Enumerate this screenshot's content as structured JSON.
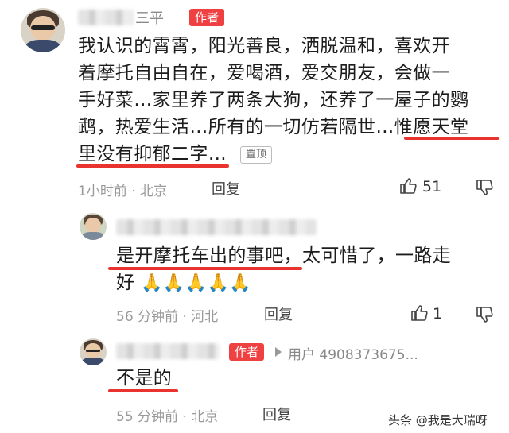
{
  "comment1": {
    "author_suffix": "三平",
    "author_tag": "作者",
    "lines": [
      "我认识的霄霄，阳光善良，洒脱温和，喜欢开",
      "着摩托自由自在，爱喝酒，爱交朋友，会做一",
      "手好菜…家里养了两条大狗，还养了一屋子的鹦",
      "鹉，热爱生活…所有的一切仿若隔世…惟愿天堂",
      "里没有抑郁二字…"
    ],
    "pin_label": "置顶",
    "meta": "1小时前 · 北京",
    "reply_label": "回复",
    "likes": "51"
  },
  "reply1": {
    "lines": [
      "是开摩托车出的事吧，太可惜了，一路走",
      "好"
    ],
    "emoji": [
      "🙏",
      "🙏",
      "🙏",
      "🙏",
      "🙏"
    ],
    "meta": "56 分钟前 · 河北",
    "reply_label": "回复",
    "likes": "1"
  },
  "reply2": {
    "author_tag": "作者",
    "reply_to": "用户 4908373675...",
    "text": "不是的",
    "meta": "55 分钟前 · 北京",
    "reply_label": "回复"
  },
  "watermark": "头条 @我是大瑞呀",
  "colors": {
    "accent_red": "#e8332f",
    "tag_red": "#f04142",
    "meta_gray": "#9a9a9a"
  },
  "icons": [
    "thumb-up-icon",
    "thumb-down-icon",
    "reply-arrow-icon"
  ]
}
